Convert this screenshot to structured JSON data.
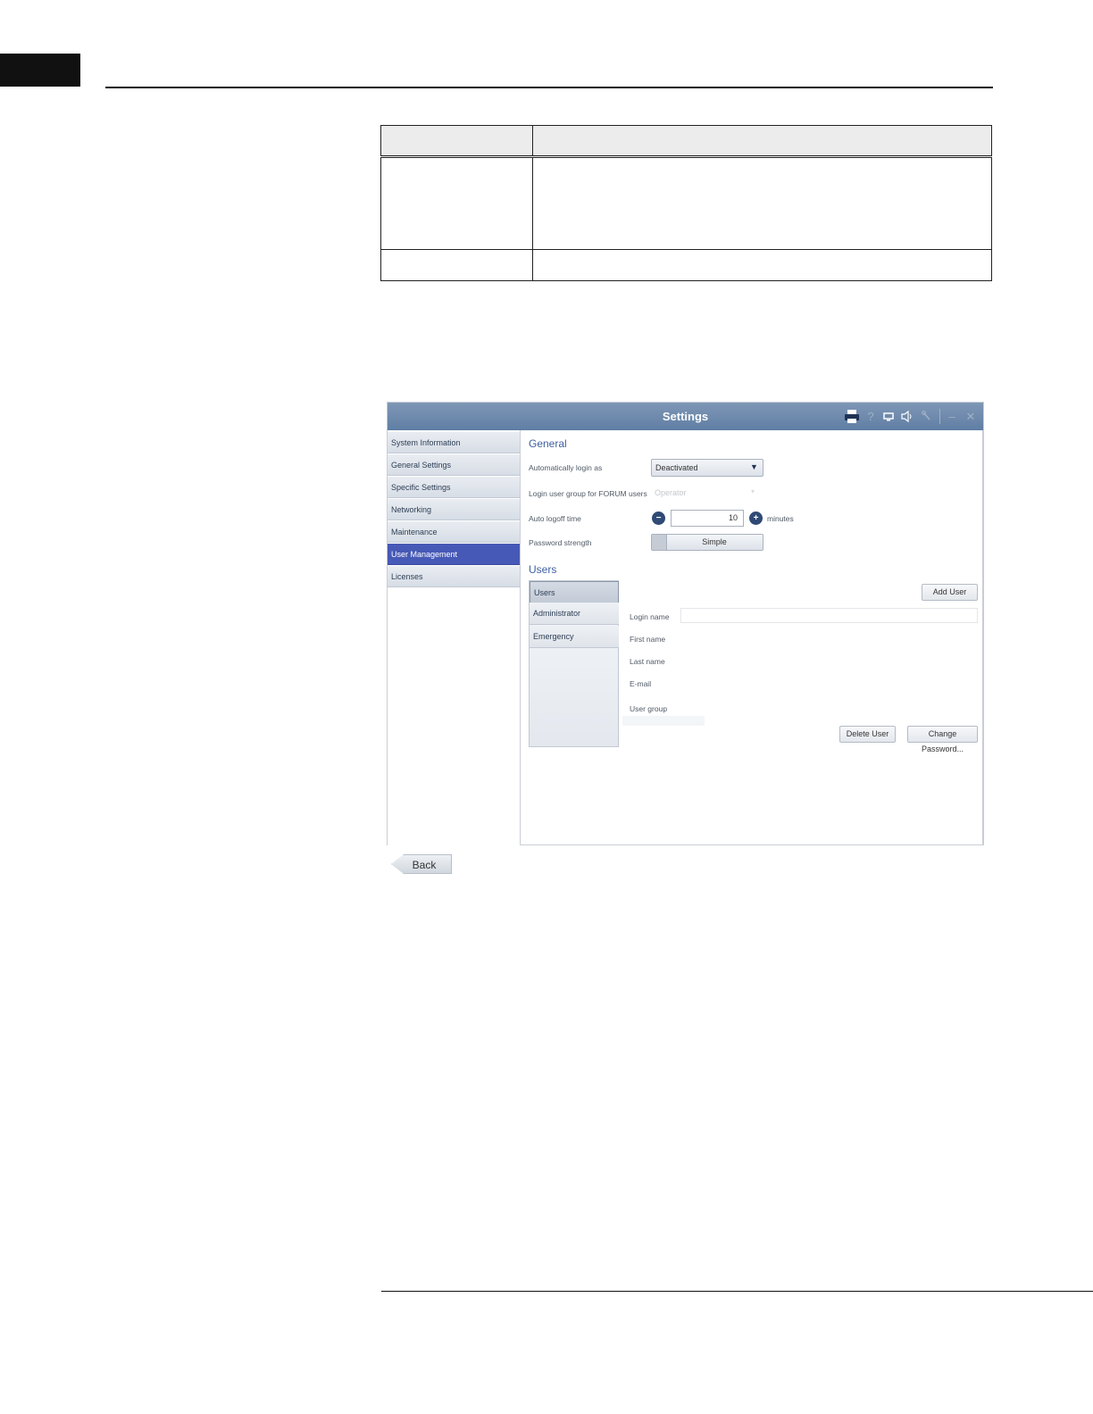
{
  "window": {
    "title": "Settings"
  },
  "toolbar_icons": [
    "printer-icon",
    "help-icon",
    "display-icon",
    "speaker-icon",
    "wrench-icon",
    "minimize-icon",
    "close-icon"
  ],
  "sidebar": {
    "items": [
      {
        "label": "System Information",
        "active": false
      },
      {
        "label": "General Settings",
        "active": false
      },
      {
        "label": "Specific Settings",
        "active": false
      },
      {
        "label": "Networking",
        "active": false
      },
      {
        "label": "Maintenance",
        "active": false
      },
      {
        "label": "User Management",
        "active": true
      },
      {
        "label": "Licenses",
        "active": false
      }
    ]
  },
  "general": {
    "title": "General",
    "auto_login_label": "Automatically login as",
    "auto_login_value": "Deactivated",
    "login_group_label": "Login user group for FORUM users",
    "login_group_value": "Operator",
    "auto_logoff_label": "Auto logoff time",
    "auto_logoff_value": "10",
    "auto_logoff_unit": "minutes",
    "password_strength_label": "Password strength",
    "password_strength_value": "Simple"
  },
  "users": {
    "title": "Users",
    "tabs": [
      "Users",
      "Administrator",
      "Emergency"
    ],
    "add_user_label": "Add User",
    "fields": [
      "Login name",
      "First name",
      "Last name",
      "E-mail",
      "User group"
    ],
    "delete_user_label": "Delete User",
    "change_password_label": "Change Password..."
  },
  "back_label": "Back",
  "colors": {
    "accent": "#4759b6",
    "titlebar": "#6b88ad",
    "section_title": "#3e5fa3"
  }
}
